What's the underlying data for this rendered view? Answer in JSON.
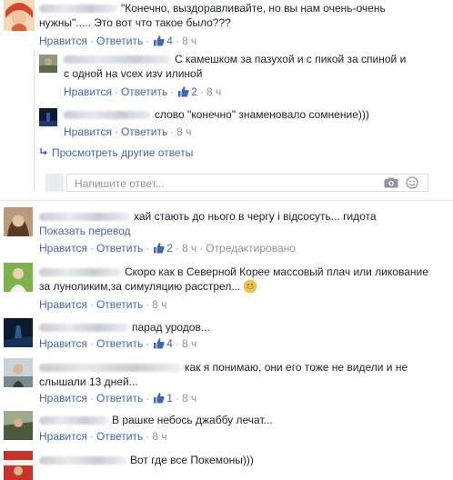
{
  "actions": {
    "like": "Нравится",
    "reply": "Ответить",
    "show_translation": "Показать перевод",
    "edited": "Отредактировано",
    "view_more_replies": "Просмотреть другие ответы"
  },
  "reply_box": {
    "placeholder": "Напишите ответ..."
  },
  "comments": [
    {
      "text": "\"Конечно, выздоравливайте, но вы нам очень-очень нужны\"..... Это вот что такое было???",
      "likes": "4",
      "time": "8 ч"
    },
    {
      "text": "С камешком за пазухой и с пикой за спиной и с одной на vсех изv илиной",
      "likes": "2",
      "time": "8 ч"
    },
    {
      "text": "слово \"конечно\" знаменовало сомнение)))",
      "time": "8 ч"
    },
    {
      "text": "хай стають до нього в чергу і відсосуть... гидота",
      "likes": "2",
      "time": "8 ч"
    },
    {
      "text": "Скоро как в Северной Корее массовый плач или ликование за луноликим,за симуляцию расстрел...",
      "time": "8 ч"
    },
    {
      "text": "парад уродов...",
      "likes": "4",
      "time": "8 ч"
    },
    {
      "text": "как я понимаю, они его тоже не видели и не слышали 13 дней...",
      "likes": "1",
      "time": "8 ч"
    },
    {
      "text": "В рашке небось джаббу лечат...",
      "time": "8 ч"
    },
    {
      "text": "Вот где все Покемоны)))"
    }
  ]
}
